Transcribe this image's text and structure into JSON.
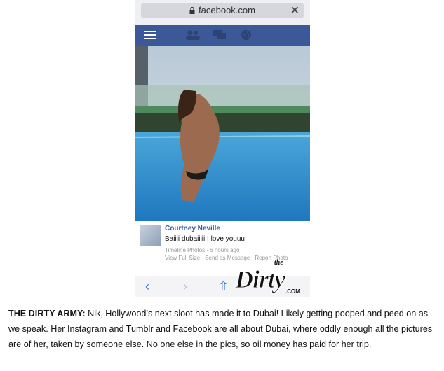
{
  "browser": {
    "url": "facebook.com",
    "lock_icon": "lock-icon",
    "close_icon": "close-icon"
  },
  "facebook_bar": {
    "icons": [
      "menu-icon",
      "friends-icon",
      "messages-icon",
      "globe-icon"
    ]
  },
  "post": {
    "name": "Courtney Neville",
    "text": "Baiiii dubaiiiii I love youuu",
    "meta_line1": "Timeline Photos · 6 hours ago",
    "meta_line2": "View Full Size · Send as Message · Report Photo"
  },
  "safari_nav": {
    "back": "‹",
    "forward": "›",
    "share": "⇧"
  },
  "watermark": {
    "top": "the",
    "main": "Dirty",
    "suffix": ".COM"
  },
  "caption": {
    "lead": "THE DIRTY ARMY:",
    "body": " Nik, Hollywood’s next sloot has made it to Dubai! Likely getting pooped and peed on as we speak. Her Instagram and Tumblr and Facebook are all about Dubai, where oddly enough all the pictures are of her, taken by someone else. No one else in the pics, so oil money has paid for her trip."
  }
}
